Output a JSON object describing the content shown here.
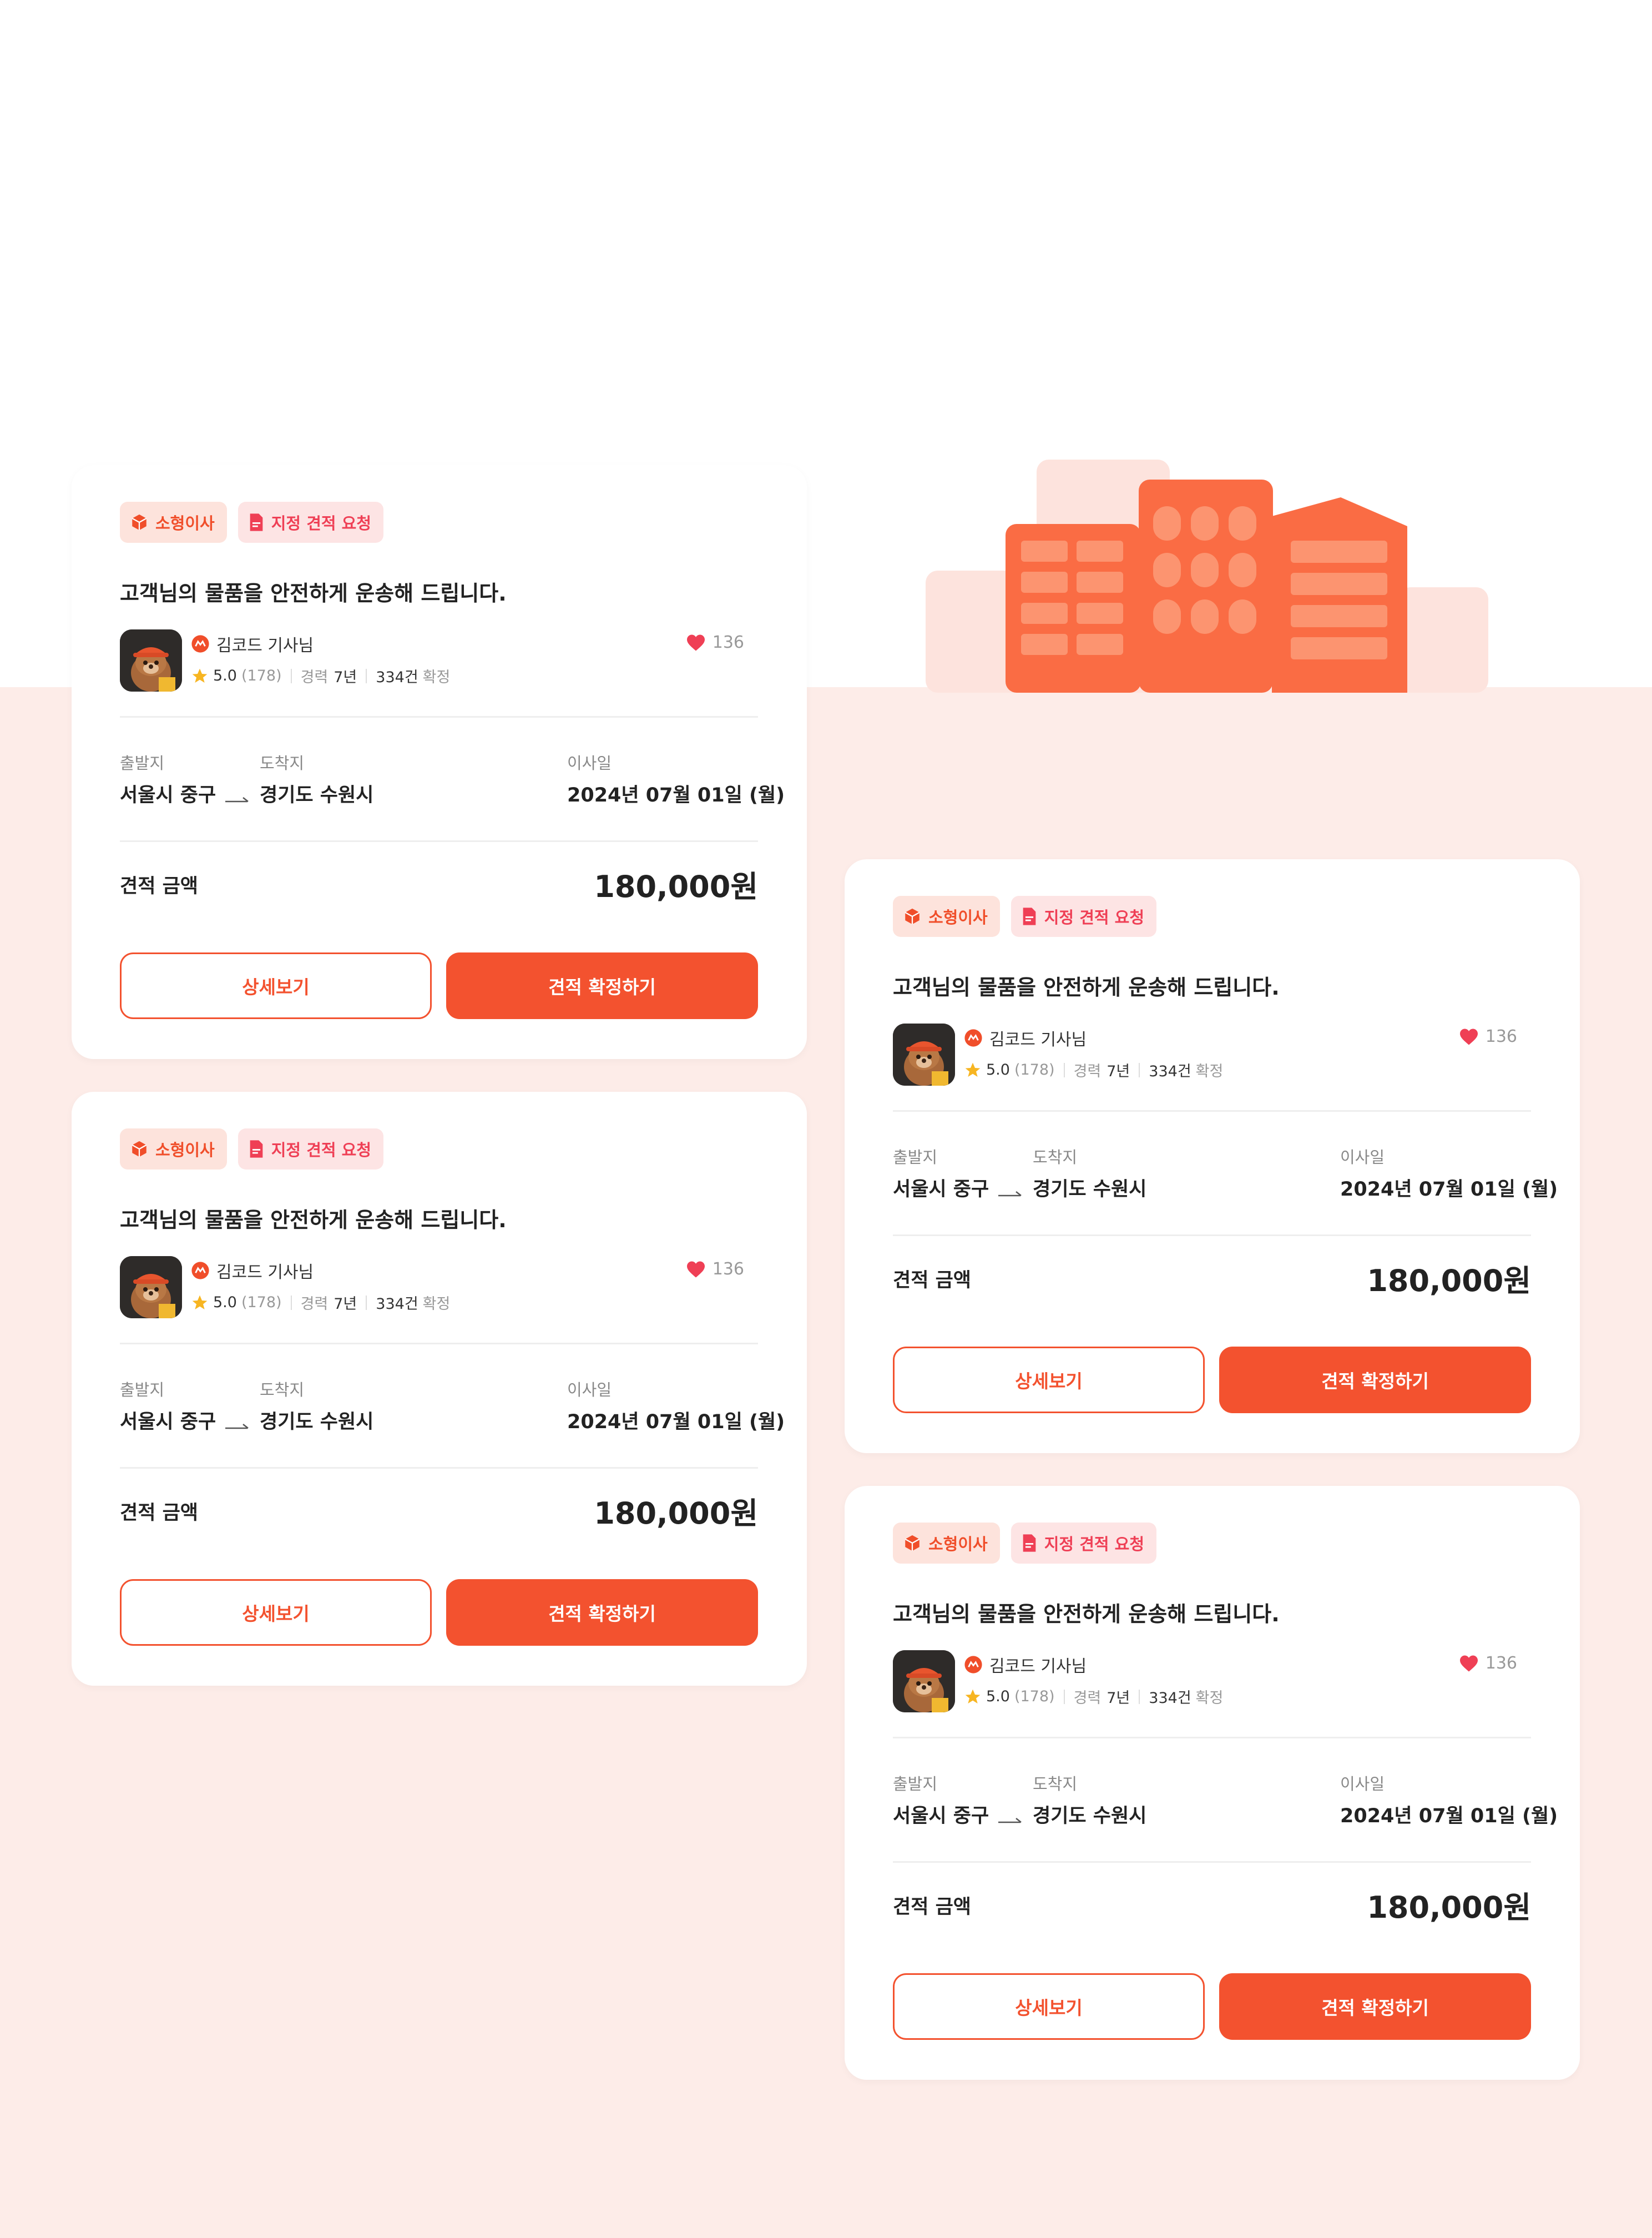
{
  "colors": {
    "accent": "#f3522f",
    "background_pink": "#fdece8",
    "heart": "#ef3f55",
    "star": "#f7b521"
  },
  "cards": [
    {
      "tags": [
        {
          "label": "소형이사",
          "icon": "box-icon"
        },
        {
          "label": "지정 견적 요청",
          "icon": "document-icon"
        }
      ],
      "headline": "고객님의 물품을 안전하게 운송해 드립니다.",
      "driver_name": "김코드 기사님",
      "rating": "5.0",
      "review_count": "(178)",
      "career_label": "경력",
      "career_value": "7년",
      "confirmed_count": "334건",
      "confirmed_label": "확정",
      "likes": "136",
      "origin_label": "출발지",
      "origin": "서울시 중구",
      "destination_label": "도착지",
      "destination": "경기도 수원시",
      "move_date_label": "이사일",
      "move_date": "2024년 07월 01일 (월)",
      "price_label": "견적 금액",
      "price": "180,000원",
      "detail_button": "상세보기",
      "confirm_button": "견적 확정하기"
    },
    {
      "tags": [
        {
          "label": "소형이사",
          "icon": "box-icon"
        },
        {
          "label": "지정 견적 요청",
          "icon": "document-icon"
        }
      ],
      "headline": "고객님의 물품을 안전하게 운송해 드립니다.",
      "driver_name": "김코드 기사님",
      "rating": "5.0",
      "review_count": "(178)",
      "career_label": "경력",
      "career_value": "7년",
      "confirmed_count": "334건",
      "confirmed_label": "확정",
      "likes": "136",
      "origin_label": "출발지",
      "origin": "서울시 중구",
      "destination_label": "도착지",
      "destination": "경기도 수원시",
      "move_date_label": "이사일",
      "move_date": "2024년 07월 01일 (월)",
      "price_label": "견적 금액",
      "price": "180,000원",
      "detail_button": "상세보기",
      "confirm_button": "견적 확정하기"
    },
    {
      "tags": [
        {
          "label": "소형이사",
          "icon": "box-icon"
        },
        {
          "label": "지정 견적 요청",
          "icon": "document-icon"
        }
      ],
      "headline": "고객님의 물품을 안전하게 운송해 드립니다.",
      "driver_name": "김코드 기사님",
      "rating": "5.0",
      "review_count": "(178)",
      "career_label": "경력",
      "career_value": "7년",
      "confirmed_count": "334건",
      "confirmed_label": "확정",
      "likes": "136",
      "origin_label": "출발지",
      "origin": "서울시 중구",
      "destination_label": "도착지",
      "destination": "경기도 수원시",
      "move_date_label": "이사일",
      "move_date": "2024년 07월 01일 (월)",
      "price_label": "견적 금액",
      "price": "180,000원",
      "detail_button": "상세보기",
      "confirm_button": "견적 확정하기"
    },
    {
      "tags": [
        {
          "label": "소형이사",
          "icon": "box-icon"
        },
        {
          "label": "지정 견적 요청",
          "icon": "document-icon"
        }
      ],
      "headline": "고객님의 물품을 안전하게 운송해 드립니다.",
      "driver_name": "김코드 기사님",
      "rating": "5.0",
      "review_count": "(178)",
      "career_label": "경력",
      "career_value": "7년",
      "confirmed_count": "334건",
      "confirmed_label": "확정",
      "likes": "136",
      "origin_label": "출발지",
      "origin": "서울시 중구",
      "destination_label": "도착지",
      "destination": "경기도 수원시",
      "move_date_label": "이사일",
      "move_date": "2024년 07월 01일 (월)",
      "price_label": "견적 금액",
      "price": "180,000원",
      "detail_button": "상세보기",
      "confirm_button": "견적 확정하기"
    }
  ]
}
